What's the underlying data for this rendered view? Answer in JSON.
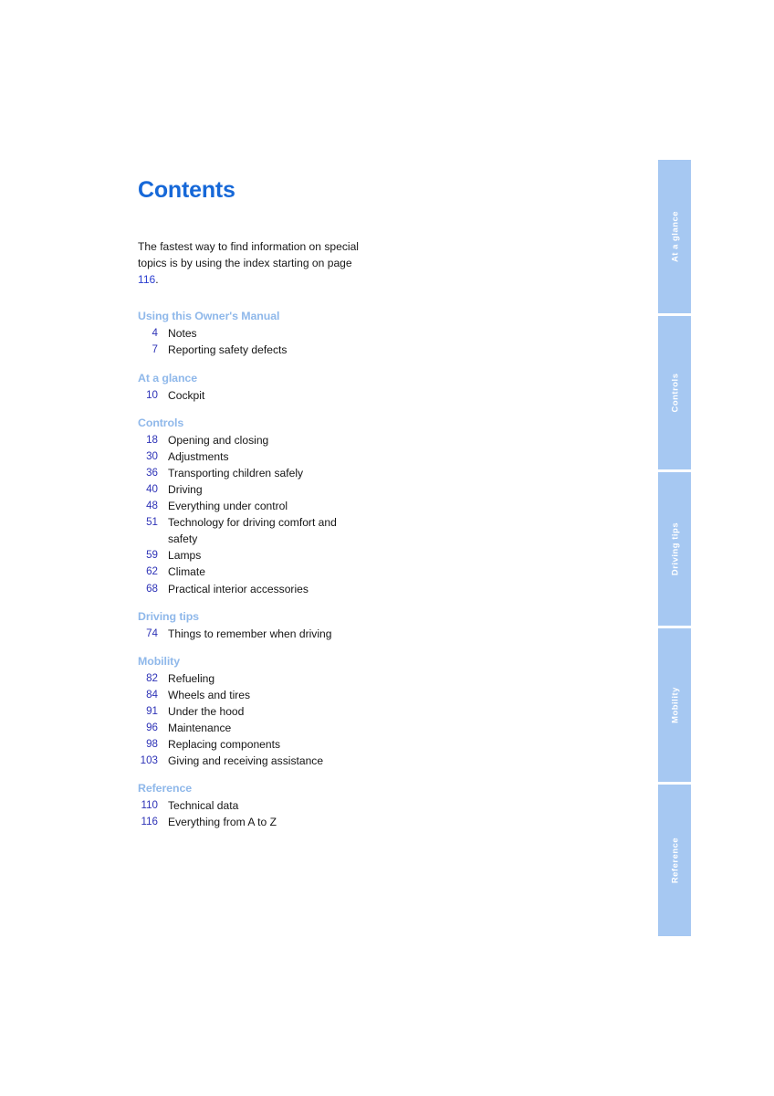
{
  "document": {
    "title": "Contents",
    "intro_text_before": "The fastest way to find information on special topics is by using the index starting on page ",
    "intro_page_ref": "116",
    "intro_text_after": ".",
    "colors": {
      "title_blue": "#1668d8",
      "section_heading_blue": "#8fb8ea",
      "page_number_blue": "#2e33b7",
      "tab_blue": "#a6c8f2",
      "tab_text": "#ffffff",
      "body_text": "#151515"
    }
  },
  "toc": {
    "sections": [
      {
        "heading": "Using this Owner's Manual",
        "entries": [
          {
            "page": "4",
            "label": "Notes"
          },
          {
            "page": "7",
            "label": "Reporting safety defects"
          }
        ]
      },
      {
        "heading": "At a glance",
        "entries": [
          {
            "page": "10",
            "label": "Cockpit"
          }
        ]
      },
      {
        "heading": "Controls",
        "entries": [
          {
            "page": "18",
            "label": "Opening and closing"
          },
          {
            "page": "30",
            "label": "Adjustments"
          },
          {
            "page": "36",
            "label": "Transporting children safely"
          },
          {
            "page": "40",
            "label": "Driving"
          },
          {
            "page": "48",
            "label": "Everything under control"
          },
          {
            "page": "51",
            "label": "Technology for driving comfort and safety"
          },
          {
            "page": "59",
            "label": "Lamps"
          },
          {
            "page": "62",
            "label": "Climate"
          },
          {
            "page": "68",
            "label": "Practical interior accessories"
          }
        ]
      },
      {
        "heading": "Driving tips",
        "entries": [
          {
            "page": "74",
            "label": "Things to remember when driving"
          }
        ]
      },
      {
        "heading": "Mobility",
        "entries": [
          {
            "page": "82",
            "label": "Refueling"
          },
          {
            "page": "84",
            "label": "Wheels and tires"
          },
          {
            "page": "91",
            "label": "Under the hood"
          },
          {
            "page": "96",
            "label": "Maintenance"
          },
          {
            "page": "98",
            "label": "Replacing components"
          },
          {
            "page": "103",
            "label": "Giving and receiving assistance"
          }
        ]
      },
      {
        "heading": "Reference",
        "entries": [
          {
            "page": "110",
            "label": "Technical data"
          },
          {
            "page": "116",
            "label": "Everything from A to Z"
          }
        ]
      }
    ]
  },
  "thumb_index": {
    "tabs": [
      {
        "label": "At a glance"
      },
      {
        "label": "Controls"
      },
      {
        "label": "Driving tips"
      },
      {
        "label": "Mobility"
      },
      {
        "label": "Reference"
      }
    ]
  }
}
